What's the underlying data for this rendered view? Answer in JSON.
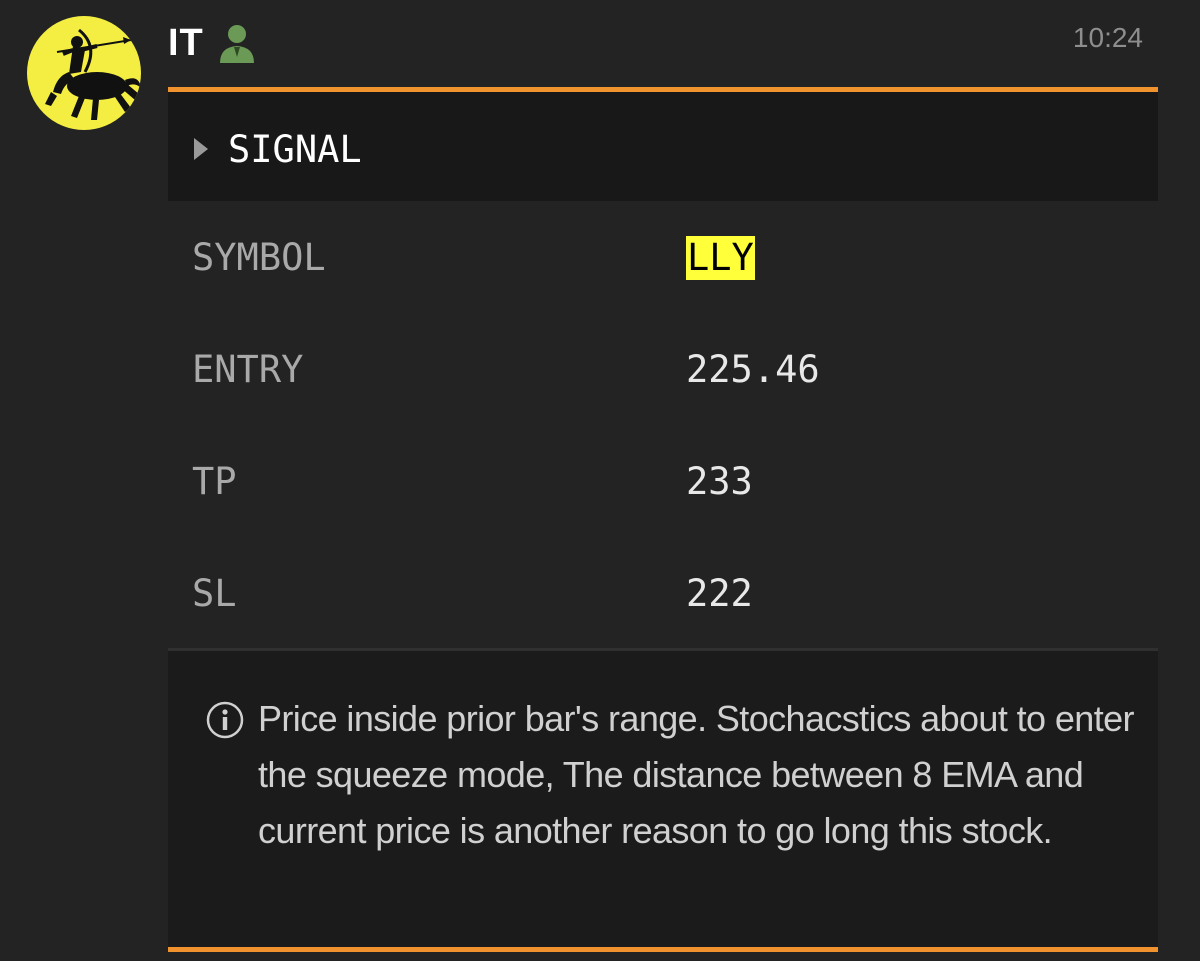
{
  "message": {
    "author": "IT",
    "timestamp": "10:24",
    "avatar_icon": "archer-centaur-icon",
    "bot_badge_icon": "user-badge-icon"
  },
  "signal": {
    "title": "SIGNAL",
    "rows": [
      {
        "label": "SYMBOL",
        "value": "LLY"
      },
      {
        "label": "ENTRY",
        "value": "225.46"
      },
      {
        "label": "TP",
        "value": "233"
      },
      {
        "label": "SL",
        "value": "222"
      }
    ],
    "note_icon": "info-icon",
    "note": "Price inside prior bar's range. Stochacstics about to enter the squeeze mode, The distance between 8 EMA and current price is another reason to go long this stock."
  },
  "colors": {
    "accent_rule": "#f0922e",
    "symbol_highlight": "#ffff3a",
    "avatar_bg": "#f4ee42",
    "bot_badge": "#6a9a55"
  }
}
